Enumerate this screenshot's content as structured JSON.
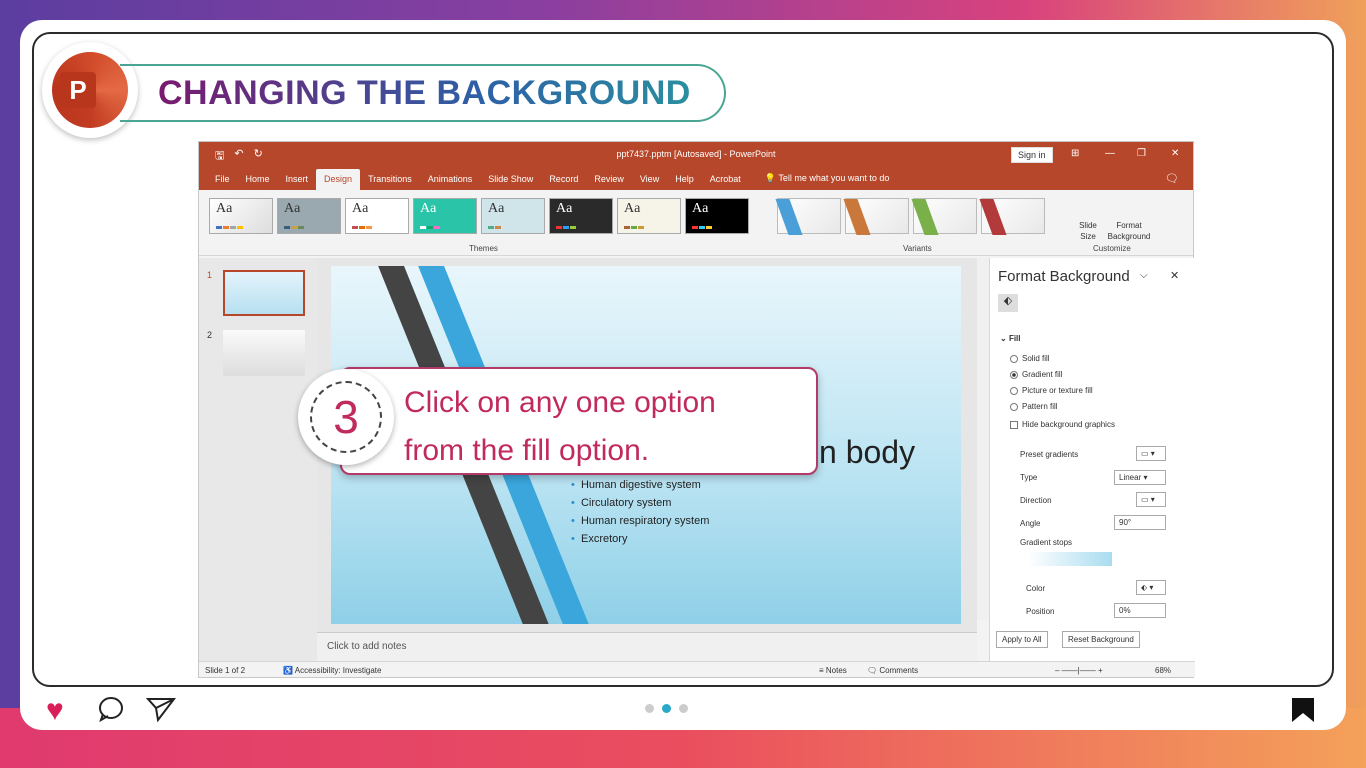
{
  "header": {
    "title": "CHANGING THE BACKGROUND",
    "logo_letter": "P"
  },
  "app": {
    "window_title": "ppt7437.pptm [Autosaved] - PowerPoint",
    "sign_in": "Sign in",
    "tabs": [
      "File",
      "Home",
      "Insert",
      "Design",
      "Transitions",
      "Animations",
      "Slide Show",
      "Record",
      "Review",
      "View",
      "Help",
      "Acrobat"
    ],
    "active_tab": "Design",
    "tell_me": "Tell me what you want to do",
    "ribbon": {
      "themes_label": "Themes",
      "variants_label": "Variants",
      "customize_label": "Customize",
      "theme_sample": "Aa",
      "slide_size": "Slide Size",
      "format_background": "Format Background"
    },
    "slide_numbers": [
      "1",
      "2"
    ],
    "slide": {
      "title_fragment": "n body",
      "bullets": [
        "Human digestive system",
        "Circulatory system",
        "Human respiratory system",
        "Excretory"
      ]
    },
    "notes_placeholder": "Click to add notes",
    "format_background": {
      "title": "Format Background",
      "section": "Fill",
      "options": [
        "Solid fill",
        "Gradient fill",
        "Picture or texture fill",
        "Pattern fill"
      ],
      "selected_option": "Gradient fill",
      "hide_graphics": "Hide background graphics",
      "preset_gradients": "Preset gradients",
      "type_label": "Type",
      "type_value": "Linear",
      "direction_label": "Direction",
      "angle_label": "Angle",
      "angle_value": "90°",
      "gradient_stops": "Gradient stops",
      "color_label": "Color",
      "position_label": "Position",
      "position_value": "0%",
      "apply_all": "Apply to All",
      "reset": "Reset Background"
    },
    "status": {
      "slide_count": "Slide 1 of 2",
      "accessibility": "Accessibility: Investigate",
      "notes": "Notes",
      "comments": "Comments",
      "zoom": "68%"
    }
  },
  "callout": {
    "step": "3",
    "line1": "Click on any one option",
    "line2": "from the fill option."
  },
  "colors": {
    "accent": "#b7472a",
    "callout": "#c02a5c",
    "teal": "#4aa593"
  }
}
